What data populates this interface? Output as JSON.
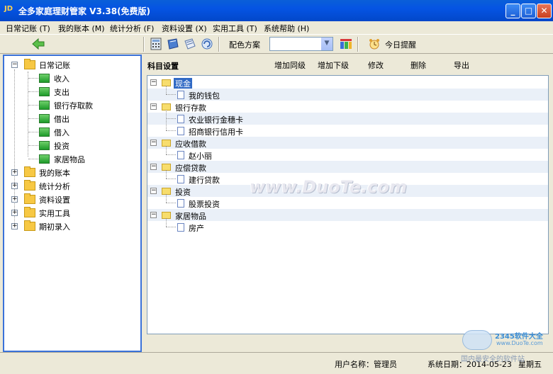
{
  "window": {
    "title": "全多家庭理财管家 V3.38(免费版)",
    "app_icon_text": "JD"
  },
  "menu": [
    {
      "label": "日常记账 (T)"
    },
    {
      "label": "我的账本 (M)"
    },
    {
      "label": "统计分析 (F)"
    },
    {
      "label": "资料设置 (X)"
    },
    {
      "label": "实用工具 (T)"
    },
    {
      "label": "系统帮助 (H)"
    }
  ],
  "toolbar": {
    "color_scheme_label": "配色方案",
    "color_scheme_value": "",
    "reminder_label": "今日提醒"
  },
  "nav_tree": {
    "root": "日常记账",
    "children": [
      "收入",
      "支出",
      "银行存取款",
      "借出",
      "借入",
      "投资",
      "家居物品"
    ],
    "others": [
      "我的账本",
      "统计分析",
      "资料设置",
      "实用工具",
      "期初录入"
    ]
  },
  "subject": {
    "title": "科目设置",
    "buttons": [
      "增加同级",
      "增加下级",
      "修改",
      "删除",
      "导出"
    ],
    "tree": [
      {
        "label": "现金",
        "children": [
          "我的钱包"
        ]
      },
      {
        "label": "银行存款",
        "children": [
          "农业银行金穗卡",
          "招商银行信用卡"
        ]
      },
      {
        "label": "应收借款",
        "children": [
          "赵小丽"
        ]
      },
      {
        "label": "应偿贷款",
        "children": [
          "建行贷款"
        ]
      },
      {
        "label": "投资",
        "children": [
          "股票投资"
        ]
      },
      {
        "label": "家居物品",
        "children": [
          "房产"
        ]
      }
    ]
  },
  "watermark": "www.DuoTe.com",
  "status": {
    "user": "用户名称：管理员",
    "date": "系统日期：2014-05-23",
    "weekday": "星期五"
  },
  "corner_logo": {
    "brand": "2345软件大全",
    "url": "www.DuoTe.com",
    "slogan": "国内最安全的软件站"
  },
  "colors": {
    "titlebar": "#0554E3",
    "selection": "#316AC5",
    "panel_border": "#3A72D9"
  }
}
